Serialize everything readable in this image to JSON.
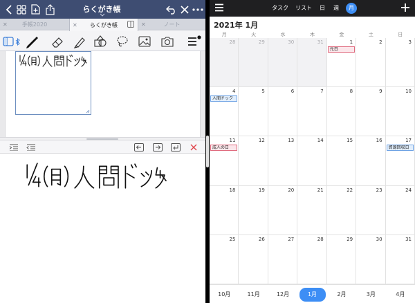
{
  "notes_app": {
    "title": "らくがき帳",
    "tabs": [
      {
        "label": "手帳2020",
        "active": false
      },
      {
        "label": "らくがき帳",
        "active": true
      },
      {
        "label": "ノート",
        "active": false
      }
    ],
    "nav_icons": [
      "back-icon",
      "grid-icon",
      "add-page-icon",
      "share-icon",
      "undo-icon",
      "close-icon",
      "more-icon"
    ],
    "tool_icons": [
      "sidebar-icon",
      "bluetooth-icon",
      "pen-icon",
      "eraser-icon",
      "marker-icon",
      "shapes-icon",
      "lasso-icon",
      "image-icon",
      "camera-icon",
      "pen-thickness-icon"
    ],
    "input_tool_icons": [
      "indent-icon",
      "outdent-icon",
      "arrow-left-icon",
      "arrow-right-icon",
      "return-icon",
      "clear-icon"
    ],
    "handwritten_text": "1/4(月) 人間ドック",
    "accent": "#3e4d72"
  },
  "calendar_app": {
    "nav_segments": [
      {
        "label": "タスク",
        "active": false
      },
      {
        "label": "リスト",
        "active": false
      },
      {
        "label": "日",
        "active": false
      },
      {
        "label": "週",
        "active": false
      },
      {
        "label": "月",
        "active": true
      }
    ],
    "month_title": "2021年 1月",
    "weekdays": [
      "月",
      "火",
      "水",
      "木",
      "金",
      "土",
      "日"
    ],
    "weeks": [
      [
        {
          "d": "28",
          "other": true
        },
        {
          "d": "29",
          "other": true
        },
        {
          "d": "30",
          "other": true
        },
        {
          "d": "31",
          "other": true
        },
        {
          "d": "1"
        },
        {
          "d": "2"
        },
        {
          "d": "3"
        }
      ],
      [
        {
          "d": "4"
        },
        {
          "d": "5"
        },
        {
          "d": "6"
        },
        {
          "d": "7"
        },
        {
          "d": "8"
        },
        {
          "d": "9"
        },
        {
          "d": "10"
        }
      ],
      [
        {
          "d": "11"
        },
        {
          "d": "12"
        },
        {
          "d": "13"
        },
        {
          "d": "14"
        },
        {
          "d": "15"
        },
        {
          "d": "16"
        },
        {
          "d": "17"
        }
      ],
      [
        {
          "d": "18"
        },
        {
          "d": "19"
        },
        {
          "d": "20"
        },
        {
          "d": "21"
        },
        {
          "d": "22"
        },
        {
          "d": "23"
        },
        {
          "d": "24"
        }
      ],
      [
        {
          "d": "25"
        },
        {
          "d": "26"
        },
        {
          "d": "27"
        },
        {
          "d": "28"
        },
        {
          "d": "29"
        },
        {
          "d": "30"
        },
        {
          "d": "31"
        }
      ]
    ],
    "events": [
      {
        "week": 0,
        "day": 4,
        "label": "元日",
        "color": "red"
      },
      {
        "week": 1,
        "day": 0,
        "label": "人間ドック",
        "color": "blue"
      },
      {
        "week": 2,
        "day": 0,
        "label": "成人の日",
        "color": "red"
      },
      {
        "week": 2,
        "day": 6,
        "label": "資源回収日",
        "color": "blue"
      }
    ],
    "months": [
      {
        "label": "10月",
        "active": false
      },
      {
        "label": "11月",
        "active": false
      },
      {
        "label": "12月",
        "active": false
      },
      {
        "label": "1月",
        "active": true
      },
      {
        "label": "2月",
        "active": false
      },
      {
        "label": "3月",
        "active": false
      },
      {
        "label": "4月",
        "active": false
      }
    ],
    "accent": "#3d8ef5",
    "event_red": "#e06a7e",
    "event_blue": "#6da2e4"
  }
}
